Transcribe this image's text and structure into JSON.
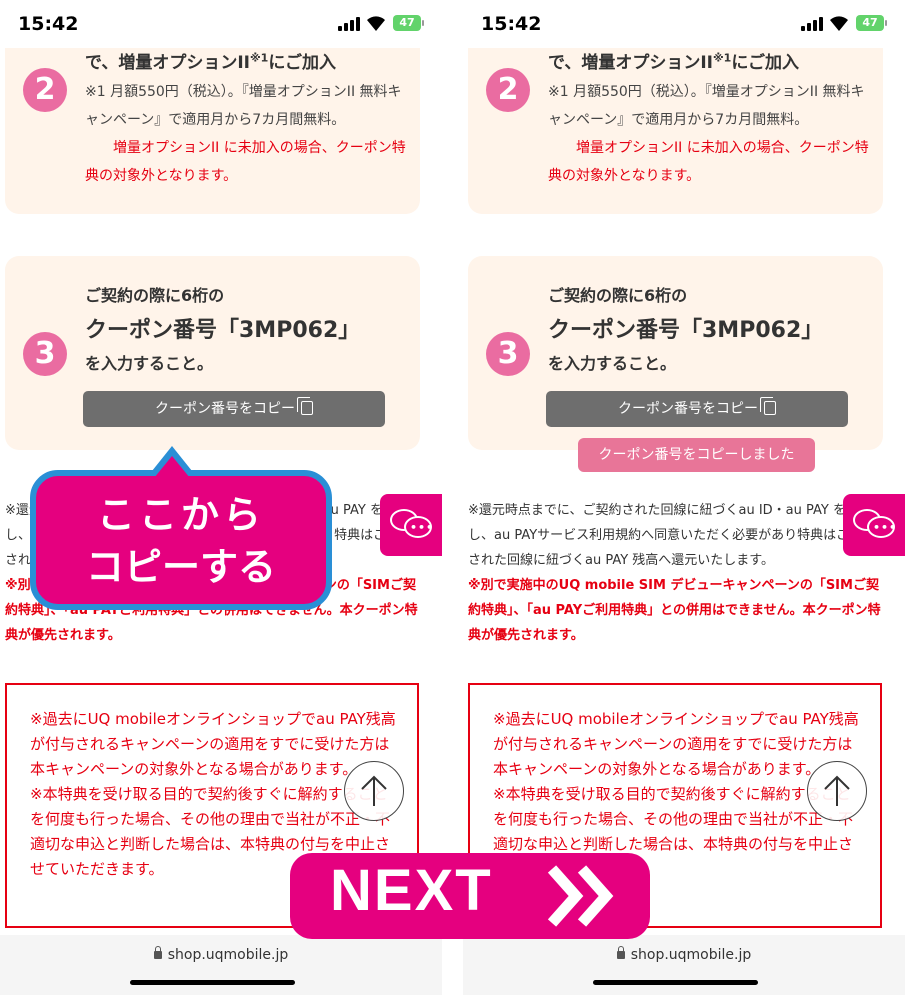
{
  "status_bar": {
    "time": "15:42",
    "battery": "47"
  },
  "step2": {
    "number": "2",
    "title_before": "で、増量オプションII",
    "title_sup": "※1",
    "title_after": "にご加入",
    "note": "※1 月額550円（税込）。『増量オプションII 無料キャンペーン』で適用月から7カ月間無料。",
    "warning": "増量オプションII に未加入の場合、クーポン特典の対象外となります。"
  },
  "step3": {
    "number": "3",
    "line1": "ご契約の際に6桁の",
    "line2": "クーポン番号「3MP062」",
    "line3": "を入力すること。",
    "copy_button": "クーポン番号をコピー"
  },
  "copied_toast": "クーポン番号をコピーしました",
  "body": {
    "text": "※還元時点までに、ご契約された回線に紐づくau ID・au PAY を取得し、au PAYサービス利用規約へ同意いただく必要があり特典はご契約された回線に紐づくau PAY 残高へ還元いたします。",
    "red": "※別で実施中のUQ mobile SIM デビューキャンペーンの「SIMご契約特典」、「au PAYご利用特典」との併用はできません。本クーポン特典が優先されます。"
  },
  "notice": {
    "p1": "※過去にUQ mobileオンラインショップでau PAY残高が付与されるキャンペーンの適用をすでに受けた方は本キャンペーンの対象外となる場合があります。",
    "p2": "※本特典を受け取る目的で契約後すぐに解約することを何度も行った場合、その他の理由で当社が不正・不適切な申込と判断した場合は、本特典の付与を中止させていただきます。"
  },
  "url": "shop.uqmobile.jp",
  "callout": {
    "line1": "ここから",
    "line2": "コピーする"
  },
  "next_banner": "NEXT",
  "colors": {
    "brand_pink": "#e5007f",
    "step_circle": "#ea6ca1",
    "card_bg": "#fff4ea",
    "alert_red": "#e60012",
    "callout_border": "#2a8fd6"
  }
}
